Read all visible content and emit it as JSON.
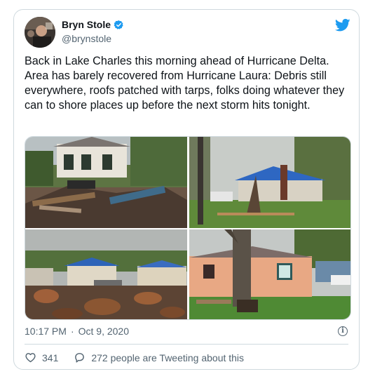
{
  "author": {
    "name": "Bryn Stole",
    "handle": "@brynstole"
  },
  "tweet": {
    "text": "Back in Lake Charles this morning ahead of Hurricane Delta. Area has barely recovered from Hurricane Laura: Debris still everywhere, roofs patched with tarps, folks doing whatever they can to shore places up before the next storm hits tonight.",
    "time": "10:17 PM",
    "separator": "·",
    "date": "Oct 9, 2020"
  },
  "actions": {
    "likes": "341",
    "conversation": "272 people are Tweeting about this"
  },
  "colors": {
    "brand": "#1d9bf0",
    "text": "#0f1419",
    "secondary": "#536471",
    "border": "#cfd9de"
  },
  "icons": [
    "twitter-bird-icon",
    "verified-badge-icon",
    "info-icon",
    "heart-icon",
    "comment-icon"
  ]
}
